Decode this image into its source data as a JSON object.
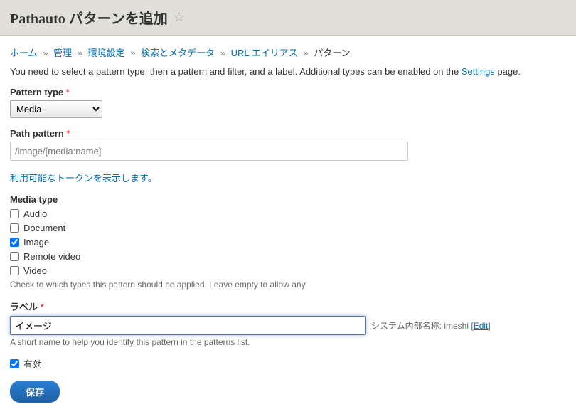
{
  "header": {
    "title": "Pathauto パターンを追加"
  },
  "breadcrumb": {
    "items": [
      "ホーム",
      "管理",
      "環境設定",
      "検索とメタデータ",
      "URL エイリアス"
    ],
    "current": "パターン"
  },
  "intro": {
    "prefix": "You need to select a pattern type, then a pattern and filter, and a label. Additional types can be enabled on the ",
    "link": "Settings",
    "suffix": " page."
  },
  "pattern_type": {
    "label": "Pattern type",
    "value": "Media"
  },
  "path_pattern": {
    "label": "Path pattern",
    "value": "/image/[media:name]"
  },
  "token_link": "利用可能なトークンを表示します。",
  "media_type": {
    "label": "Media type",
    "options": [
      {
        "label": "Audio",
        "checked": false
      },
      {
        "label": "Document",
        "checked": false
      },
      {
        "label": "Image",
        "checked": true
      },
      {
        "label": "Remote video",
        "checked": false
      },
      {
        "label": "Video",
        "checked": false
      }
    ],
    "description": "Check to which types this pattern should be applied. Leave empty to allow any."
  },
  "label_field": {
    "label": "ラベル",
    "value": "イメージ",
    "machine_prefix": "システム内部名称: ",
    "machine_name": "imeshi",
    "edit": "Edit",
    "description": "A short name to help you identify this pattern in the patterns list."
  },
  "enabled": {
    "label": "有効",
    "checked": true
  },
  "buttons": {
    "save": "保存"
  }
}
